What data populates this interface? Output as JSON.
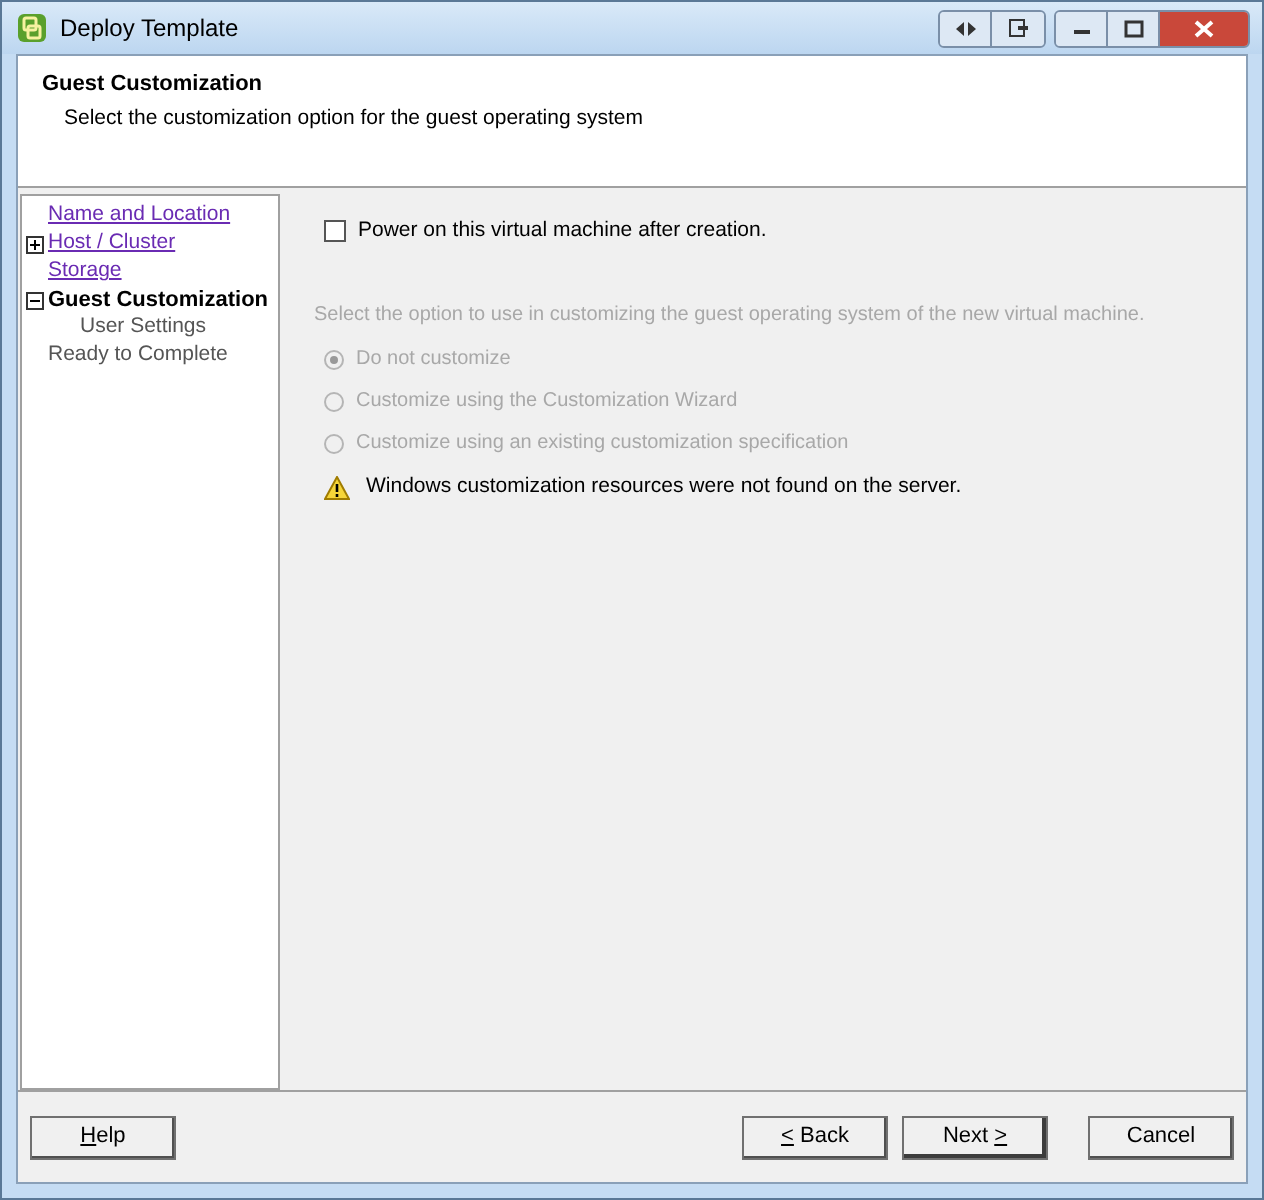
{
  "window": {
    "title": "Deploy Template"
  },
  "header": {
    "title": "Guest Customization",
    "subtitle": "Select the customization option for the guest operating system"
  },
  "sidebar": {
    "items": [
      {
        "label": "Name and Location",
        "kind": "link",
        "selected": false
      },
      {
        "label": "Host / Cluster",
        "kind": "link",
        "selected": false,
        "expanded": false
      },
      {
        "label": "Storage",
        "kind": "link",
        "selected": false
      },
      {
        "label": "Guest Customization",
        "kind": "plain",
        "selected": true,
        "expanded": true,
        "children": [
          {
            "label": "User Settings",
            "kind": "plain",
            "selected": false
          }
        ]
      },
      {
        "label": "Ready to Complete",
        "kind": "plain",
        "selected": false
      }
    ]
  },
  "power_on": {
    "label": "Power on this virtual machine after creation.",
    "checked": false
  },
  "instruction": "Select the option to use in customizing the guest operating system of the new virtual machine.",
  "options": [
    {
      "label": "Do not customize",
      "selected": true,
      "disabled": true
    },
    {
      "label": "Customize using the Customization Wizard",
      "selected": false,
      "disabled": true
    },
    {
      "label": "Customize using an existing customization specification",
      "selected": false,
      "disabled": true
    }
  ],
  "warning": "Windows customization resources were not found on the server.",
  "buttons": [
    {
      "parts": [
        {
          "text": "H",
          "underlined": true
        },
        {
          "text": "elp",
          "underlined": false
        }
      ],
      "default": false
    },
    {
      "parts": [
        {
          "text": "<",
          "underlined": true
        },
        {
          "text": " Back",
          "underlined": false
        }
      ],
      "default": false
    },
    {
      "parts": [
        {
          "text": "Next ",
          "underlined": false
        },
        {
          "text": ">",
          "underlined": true
        }
      ],
      "default": true
    },
    {
      "parts": [
        {
          "text": "Cancel",
          "underlined": false
        }
      ],
      "default": false
    }
  ]
}
